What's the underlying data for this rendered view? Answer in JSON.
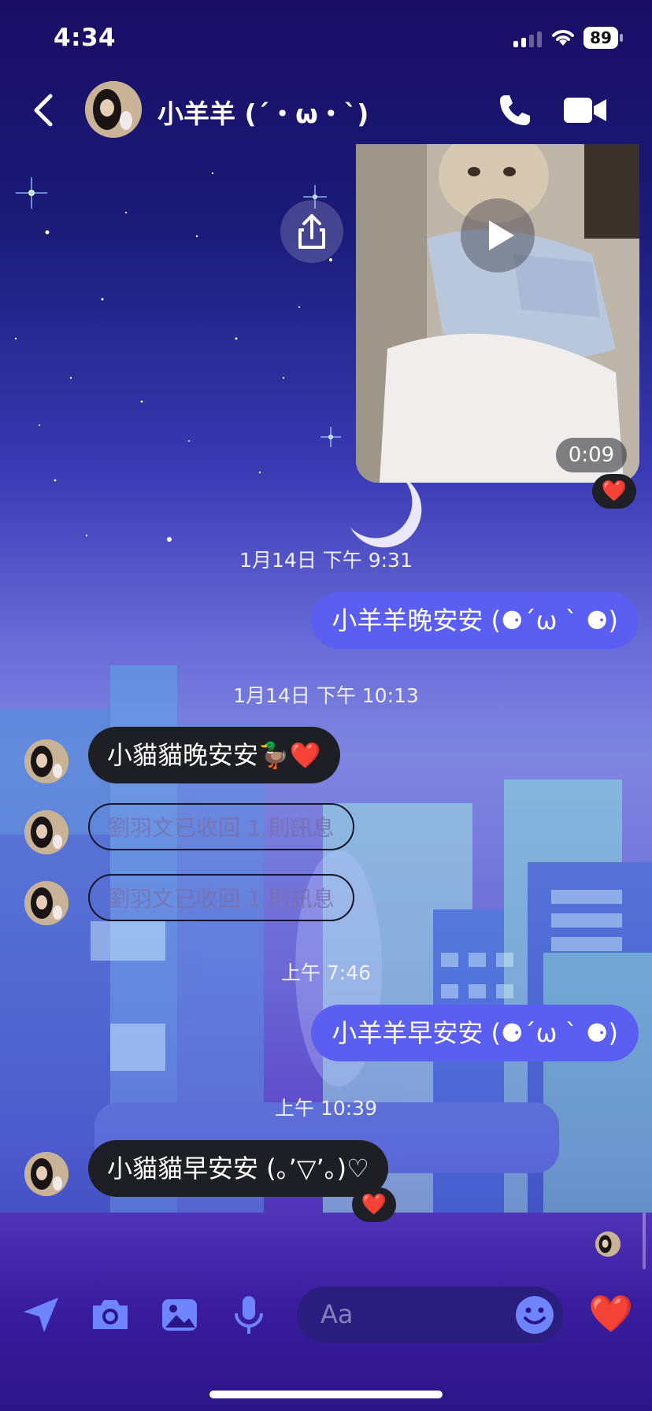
{
  "status_bar": {
    "time": "4:34",
    "battery": "89"
  },
  "header": {
    "contact_name": "小羊羊 (´・ω・`)"
  },
  "video_message": {
    "duration": "0:09",
    "reaction": "❤️"
  },
  "timestamps": {
    "t1": "1月14日 下午 9:31",
    "t2": "1月14日 下午 10:13",
    "t3": "上午 7:46",
    "t4": "上午 10:39"
  },
  "messages": {
    "out_1": "小羊羊晚安安 (⚈´ω ` ⚈)",
    "in_1": "小貓貓晚安安🦆❤️",
    "retracted_1": "劉羽文已收回 1 則訊息",
    "retracted_2": "劉羽文已收回 1 則訊息",
    "out_2": "小羊羊早安安 (⚈´ω ` ⚈)",
    "in_2": "小貓貓早安安 (。’▽’。)♡",
    "in_2_reaction": "❤️"
  },
  "composer": {
    "placeholder": "Aa",
    "like_emoji": "❤️"
  },
  "colors": {
    "outgoing_bubble": "#5a5ef1",
    "incoming_bubble": "#1e1e25",
    "background_top": "#1a0d63"
  },
  "icons": [
    "back-chevron-icon",
    "phone-icon",
    "video-call-icon",
    "play-icon",
    "share-icon",
    "send-arrow-icon",
    "camera-icon",
    "gallery-icon",
    "microphone-icon",
    "emoji-icon",
    "heart-icon"
  ]
}
